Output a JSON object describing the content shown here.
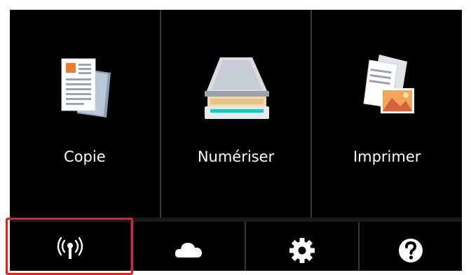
{
  "home": {
    "functions": [
      {
        "id": "copy",
        "label": "Copie"
      },
      {
        "id": "scan",
        "label": "Numériser"
      },
      {
        "id": "print",
        "label": "Imprimer"
      }
    ],
    "bottom_buttons": [
      {
        "id": "wireless",
        "icon": "wireless-antenna-icon",
        "selected": true
      },
      {
        "id": "cloud",
        "icon": "cloud-icon",
        "selected": false
      },
      {
        "id": "settings",
        "icon": "gear-icon",
        "selected": false
      },
      {
        "id": "help",
        "icon": "help-icon",
        "selected": false
      }
    ]
  },
  "colors": {
    "background": "#000000",
    "selection_border": "#e2221e",
    "label_text": "#ffffff"
  }
}
